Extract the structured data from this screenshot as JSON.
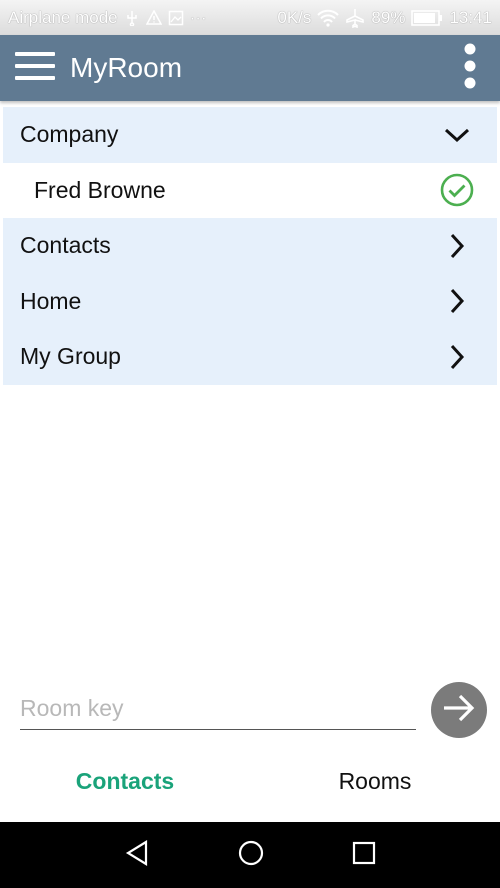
{
  "status_bar": {
    "left_text": "Airplane mode",
    "speed": "0K/s",
    "battery": "89%",
    "time": "13:41"
  },
  "app_bar": {
    "title": "MyRoom"
  },
  "list": [
    {
      "label": "Company",
      "type": "group",
      "trail": "chevron-down"
    },
    {
      "label": "Fred Browne",
      "type": "child",
      "trail": "check-circle"
    },
    {
      "label": "Contacts",
      "type": "group",
      "trail": "chevron-right"
    },
    {
      "label": "Home",
      "type": "group",
      "trail": "chevron-right"
    },
    {
      "label": "My Group",
      "type": "group",
      "trail": "chevron-right"
    }
  ],
  "room_key": {
    "placeholder": "Room key",
    "value": ""
  },
  "tabs": [
    {
      "label": "Contacts",
      "active": true
    },
    {
      "label": "Rooms",
      "active": false
    }
  ],
  "colors": {
    "app_bar": "#607a92",
    "group_row": "#e6f0fb",
    "active_tab": "#1aa37a",
    "check": "#4caf50",
    "go_button": "#7b7b7b"
  }
}
